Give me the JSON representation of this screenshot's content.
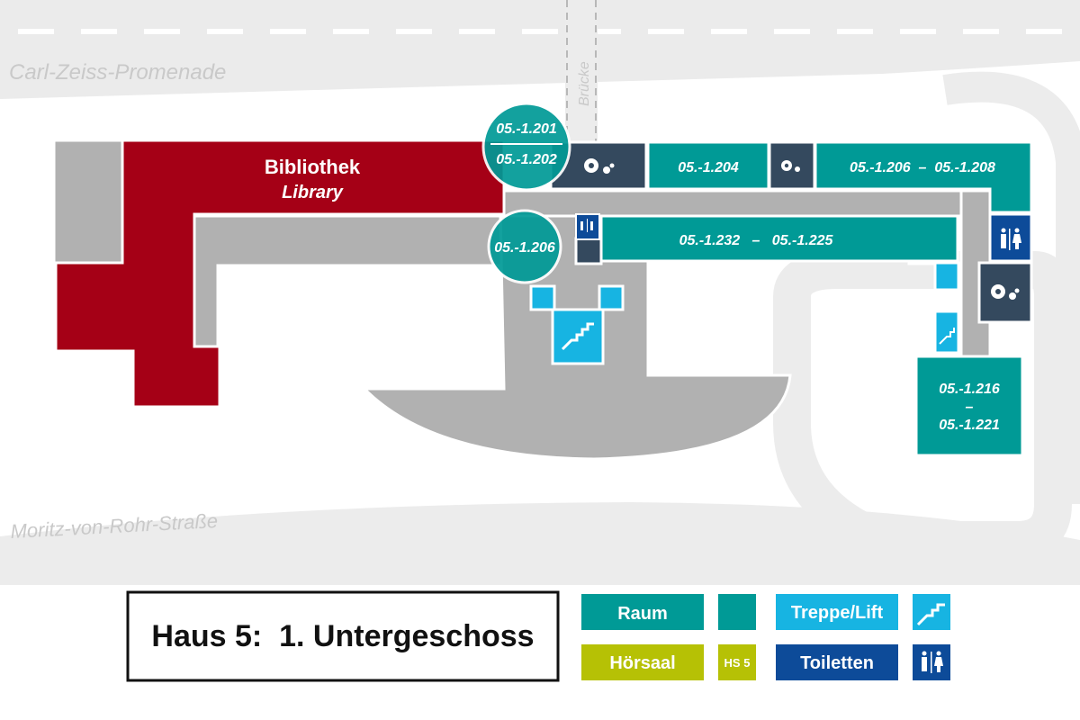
{
  "streets": {
    "north": "Carl-Zeiss-Promenade",
    "south": "Moritz-von-Rohr-Straße",
    "bridge": "Brücke"
  },
  "library": {
    "name_de": "Bibliothek",
    "name_en": "Library"
  },
  "rooms": {
    "r1201": "05.-1.201",
    "r1202": "05.-1.202",
    "r1206_circle": "05.-1.206",
    "r1204": "05.-1.204",
    "r1206_1208": "05.-1.206  –  05.-1.208",
    "r1232_1225": "05.-1.232   –   05.-1.225",
    "r1216_line1": "05.-1.216",
    "r1216_line2": "–",
    "r1216_line3": "05.-1.221"
  },
  "title": "Haus 5:  1. Untergeschoss",
  "legend": {
    "room": "Raum",
    "lecture_hall": "Hörsaal",
    "lecture_hall_sample": "HS 5",
    "stairs_lift": "Treppe/Lift",
    "toilets": "Toiletten"
  },
  "colors": {
    "teal": "#009a96",
    "library_red": "#a50016",
    "dark_slate": "#34495e",
    "light_cyan": "#17b4e2",
    "toilet_blue": "#0d4b99",
    "lecture_olive": "#b6c105",
    "corridor_gray": "#b1b1b1",
    "street_gray": "#ececec"
  },
  "icons": [
    "gear-icon",
    "stairs-icon",
    "toilet-icon"
  ]
}
